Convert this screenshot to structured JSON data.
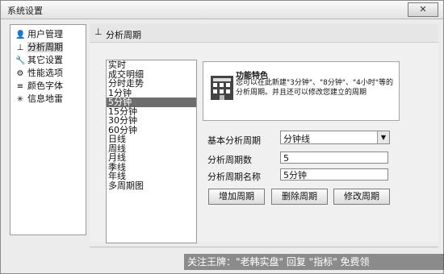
{
  "window": {
    "title": "系统设置",
    "close_label": "✕"
  },
  "nav": {
    "items": [
      {
        "label": "用户管理",
        "icon": "user-icon",
        "glyph": "👤"
      },
      {
        "label": "分析周期",
        "icon": "period-icon",
        "glyph": "⊥"
      },
      {
        "label": "其它设置",
        "icon": "tools-icon",
        "glyph": "🔧"
      },
      {
        "label": "性能选项",
        "icon": "performance-icon",
        "glyph": "⚙"
      },
      {
        "label": "颜色字体",
        "icon": "color-font-icon",
        "glyph": "≡"
      },
      {
        "label": "信息地雷",
        "icon": "info-mine-icon",
        "glyph": "✳"
      }
    ],
    "selected_index": 1
  },
  "content": {
    "header_label": "分析周期",
    "header_icon": "period-icon",
    "period_list": [
      "实时",
      "成交明细",
      "分时走势",
      "1分钟",
      "5分钟",
      "15分钟",
      "30分钟",
      "60分钟",
      "日线",
      "周线",
      "月线",
      "季线",
      "年线",
      "多周期图"
    ],
    "selected_period_index": 4,
    "feature": {
      "title": "功能特色",
      "description": "您可以在此新建\"3分钟\"、\"8分钟\"、\"4小时\"等的分析周期。并且还可以修改您建立的周期"
    },
    "form": {
      "base_period_label": "基本分析周期",
      "base_period_value": "分钟线",
      "period_count_label": "分析周期数",
      "period_count_value": "5",
      "period_name_label": "分析周期名称",
      "period_name_value": "5分钟"
    },
    "buttons": {
      "add": "增加周期",
      "delete": "删除周期",
      "modify": "修改周期"
    }
  },
  "watermark": "关注王牌：\"老韩实盘\" 回复 \"指标\" 免费领"
}
